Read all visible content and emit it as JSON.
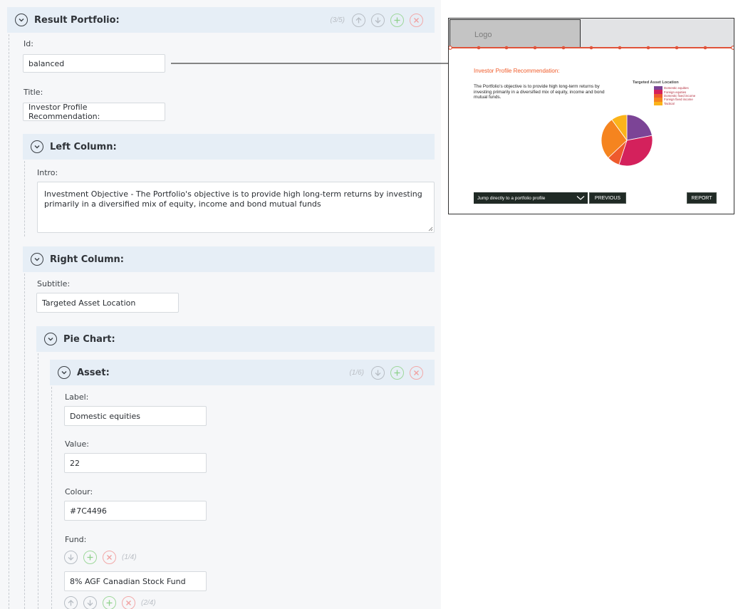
{
  "result_portfolio": {
    "title": "Result Portfolio:",
    "counter": "(3/5)",
    "id_label": "Id:",
    "id_value": "balanced",
    "title_label": "Title:",
    "title_value": "Investor Profile Recommendation:"
  },
  "left_column": {
    "title": "Left Column:",
    "intro_label": "Intro:",
    "intro_value": "Investment Objective - The Portfolio's objective is to provide high long-term returns by investing primarily in a diversified mix of equity, income and bond mutual funds"
  },
  "right_column": {
    "title": "Right Column:",
    "subtitle_label": "Subtitle:",
    "subtitle_value": "Targeted Asset Location"
  },
  "pie_chart_section": {
    "title": "Pie Chart:"
  },
  "asset": {
    "title": "Asset:",
    "counter": "(1/6)",
    "label_label": "Label:",
    "label_value": "Domestic equities",
    "value_label": "Value:",
    "value_value": "22",
    "colour_label": "Colour:",
    "colour_value": "#7C4496",
    "fund_label": "Fund:",
    "fund_counter": "(1/4)",
    "fund_value": "8% AGF Canadian Stock Fund",
    "fund2_counter": "(2/4)"
  },
  "preview": {
    "logo": "Logo",
    "title": "Investor Profile Recommendation:",
    "intro": "The Portfolio's objective is to provide high long-term returns by investing primarily in a diversified mix of equity, income and bond mutual funds.",
    "subtitle": "Targeted Asset Location",
    "jump_label": "Jump directly to a portfolio profile",
    "previous_label": "PREVIOUS",
    "report_label": "REPORT",
    "accent_color": "#F05A28",
    "dark_color": "#202A25"
  },
  "chart_data": {
    "type": "pie",
    "title": "Targeted Asset Location",
    "categories": [
      "Domestic equities",
      "Foreign equities",
      "Domestic fixed income",
      "Foreign fixed income",
      "Tactical"
    ],
    "values": [
      22,
      33,
      8,
      27,
      10
    ],
    "colors": [
      "#7C4496",
      "#D4215C",
      "#EE5A2D",
      "#F5841F",
      "#FBB31A"
    ],
    "legend": "top-right"
  },
  "icons": {
    "toggle": "chevron-down-circle-icon",
    "up": "arrow-up-circle-icon",
    "down": "arrow-down-circle-icon",
    "add": "plus-circle-icon",
    "remove": "x-circle-icon"
  }
}
